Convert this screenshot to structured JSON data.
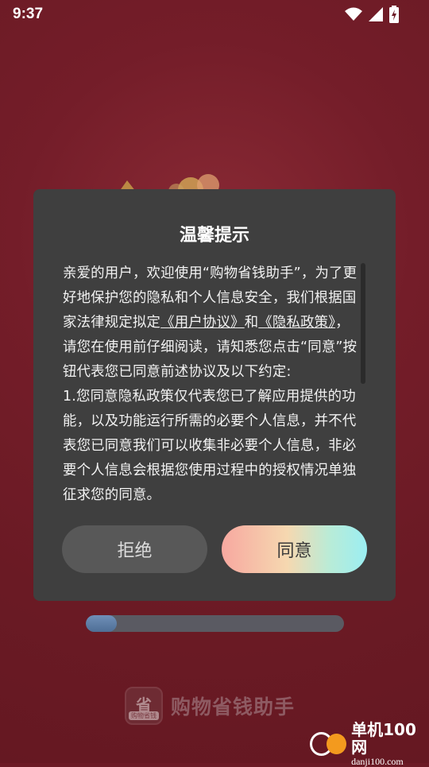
{
  "status_bar": {
    "time": "9:37",
    "icons": [
      "wifi-icon",
      "cell-signal-icon",
      "battery-charging-icon"
    ]
  },
  "dialog": {
    "title": "温馨提示",
    "paragraph_1_a": "亲爱的用户，欢迎使用“购物省钱助手”，为了更好地保护您的隐私和个人信息安全，我们根据国家法律规定拟定",
    "user_agreement_link": "《用户协议》",
    "and_text": "和",
    "privacy_policy_link": "《隐私政策》",
    "paragraph_1_b": "，请您在使用前仔细阅读，请知悉您点击“同意”按钮代表您已同意前述协议及以下约定:",
    "paragraph_2": "1.您同意隐私政策仅代表您已了解应用提供的功能，以及功能运行所需的必要个人信息，并不代表您已同意我们可以收集非必要个人信息，非必要个人信息会根据您使用过程中的授权情况单独征求您的同意。",
    "reject_label": "拒绝",
    "agree_label": "同意"
  },
  "progress": {
    "value_percent": 12
  },
  "brand": {
    "logo_char": "省",
    "logo_sub": "购物省钱",
    "name": "购物省钱助手"
  },
  "watermark": {
    "title": "单机100网",
    "url": "danji100.com"
  },
  "colors": {
    "background": "#6c1a25",
    "dialog": "#3f3f3f",
    "reject_button": "#585858",
    "agree_gradient_start": "#f7a8a0",
    "agree_gradient_end": "#9beef2"
  }
}
